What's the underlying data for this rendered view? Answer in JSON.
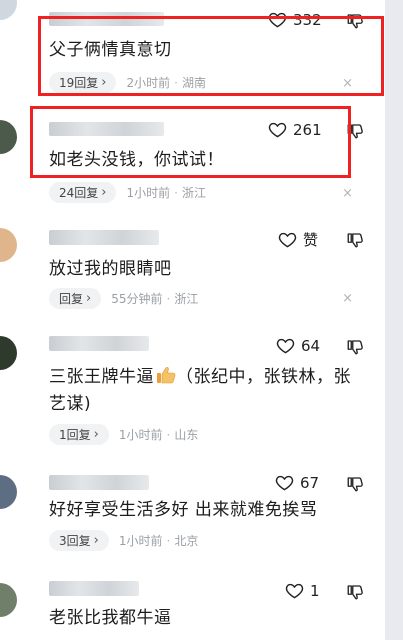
{
  "comments": [
    {
      "text": "父子俩情真意切",
      "replies": "19回复",
      "time": "2小时前",
      "location": "湖南",
      "likes": "332"
    },
    {
      "text": "如老头没钱，你试试！",
      "replies": "24回复",
      "time": "1小时前",
      "location": "浙江",
      "likes": "261"
    },
    {
      "text": "放过我的眼睛吧",
      "replies": "回复",
      "time": "55分钟前",
      "location": "浙江",
      "likes": "赞"
    },
    {
      "text_line1": "三张王牌牛逼",
      "text_line1b": "（张纪中，张铁林，张",
      "text_line2": "艺谋)",
      "replies": "1回复",
      "time": "1小时前",
      "location": "山东",
      "likes": "64"
    },
    {
      "text": "好好享受生活多好 出来就难免挨骂",
      "replies": "3回复",
      "time": "1小时前",
      "location": "北京",
      "likes": "67"
    },
    {
      "text": "老张比我都牛逼",
      "likes": "1"
    }
  ],
  "dot": "·",
  "chevron": "›",
  "close": "×",
  "colors": {
    "highlight": "#ee2222",
    "meta": "#9aa0a6"
  },
  "icons": [
    "heart-icon",
    "dislike-icon",
    "close-icon",
    "thumbs-up-emoji"
  ]
}
